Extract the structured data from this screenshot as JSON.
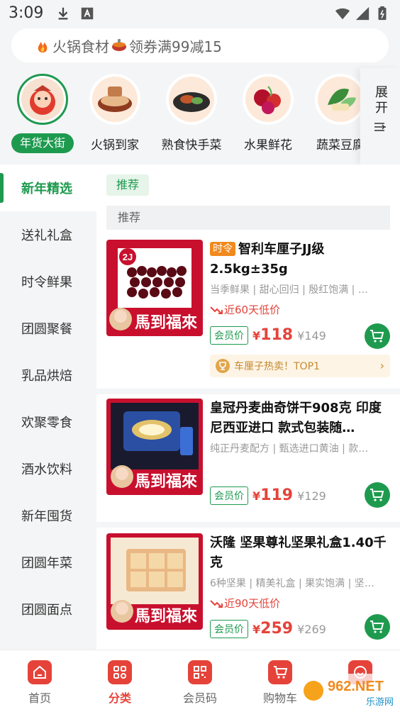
{
  "status": {
    "time": "3:09"
  },
  "search": {
    "text": "火锅食材",
    "text2": "领券满99减15"
  },
  "categories": [
    {
      "label": "年货大街",
      "active": true
    },
    {
      "label": "火锅到家"
    },
    {
      "label": "熟食快手菜"
    },
    {
      "label": "水果鲜花"
    },
    {
      "label": "蔬菜豆腐"
    }
  ],
  "expand_label": "展开",
  "sidebar": {
    "items": [
      {
        "label": "新年精选"
      },
      {
        "label": "送礼礼盒"
      },
      {
        "label": "时令鲜果"
      },
      {
        "label": "团圆聚餐"
      },
      {
        "label": "乳品烘焙"
      },
      {
        "label": "欢聚零食"
      },
      {
        "label": "酒水饮料"
      },
      {
        "label": "新年囤货"
      },
      {
        "label": "团圆年菜"
      },
      {
        "label": "团圆面点"
      }
    ]
  },
  "main": {
    "chip": "推荐",
    "section": "推荐",
    "products": [
      {
        "badge": "时令",
        "title": "智利车厘子JJ级 2.5kg±35g",
        "sub": "当季鲜果 | 甜心回归 | 殷红饱满 | …",
        "low": "近60天低价",
        "member": "会员价",
        "currency": "¥",
        "price": "118",
        "old": "¥149",
        "hot": "车厘子热卖！TOP1",
        "img_text": "馬到福來",
        "img_tag": "2J"
      },
      {
        "title": "皇冠丹麦曲奇饼干908克 印度尼西亚进口 款式包装随…",
        "sub": "纯正丹麦配方 | 甄选进口黄油 | 款…",
        "member": "会员价",
        "currency": "¥",
        "price": "119",
        "old": "¥129",
        "img_text": "馬到福來"
      },
      {
        "title": "沃隆 坚果尊礼坚果礼盒1.40千克",
        "sub": "6种坚果 | 精美礼盒 | 果实饱满 | 坚…",
        "low": "近90天低价",
        "member": "会员价",
        "currency": "¥",
        "price": "259",
        "old": "¥269",
        "img_text": "馬到福來"
      }
    ]
  },
  "tabbar": [
    {
      "label": "首页"
    },
    {
      "label": "分类",
      "active": true
    },
    {
      "label": "会员码"
    },
    {
      "label": "购物车"
    },
    {
      "label": ""
    }
  ],
  "watermark": {
    "text": "962.NET",
    "sub": "乐游网"
  },
  "colors": {
    "brand_green": "#1e9a4f",
    "price_red": "#e5433a",
    "seasonal_orange": "#f08a1d"
  }
}
